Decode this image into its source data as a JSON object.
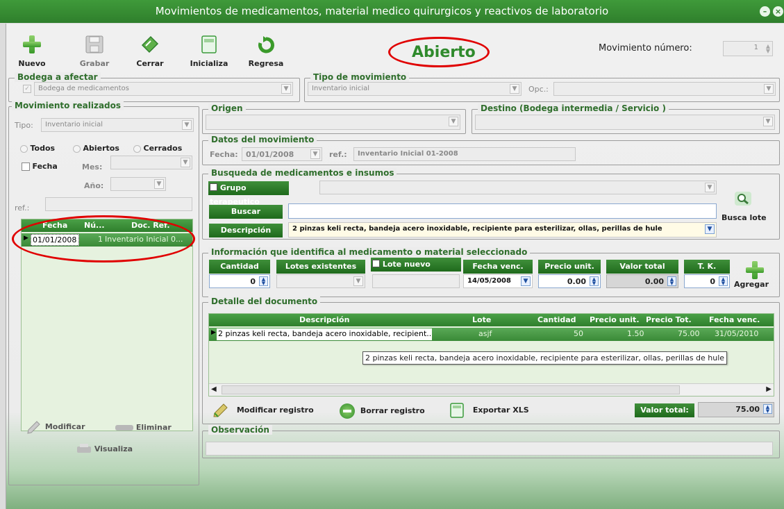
{
  "window": {
    "title": "Movimientos de medicamentos, material medico quirurgicos y reactivos de laboratorio",
    "minimize_icon": "minus-circle-icon",
    "close_icon": "close-circle-icon"
  },
  "toolbar": {
    "nuevo": "Nuevo",
    "grabar": "Grabar",
    "cerrar": "Cerrar",
    "inicializa": "Inicializa",
    "regresa": "Regresa"
  },
  "status": "Abierto",
  "movimiento": {
    "label": "Movimiento número:",
    "value": "1"
  },
  "bodega": {
    "legend": "Bodega a afectar",
    "value": "Bodega de medicamentos"
  },
  "tipo_movimiento": {
    "legend": "Tipo de movimiento",
    "value": "Inventario inicial",
    "opc_label": "Opc.:"
  },
  "realizados": {
    "legend": "Movimiento realizados",
    "tipo_label": "Tipo:",
    "tipo_value": "Inventario inicial",
    "todos": "Todos",
    "abiertos": "Abiertos",
    "cerrados": "Cerrados",
    "fecha_label": "Fecha",
    "mes_label": "Mes:",
    "anio_label": "Año:",
    "ref_label": "ref.:",
    "grid": {
      "headers": [
        "Fecha",
        "Nú...",
        "Doc. Ref."
      ],
      "rows": [
        {
          "fecha": "01/01/2008",
          "num": "1",
          "doc": "Inventario Inicial 0..."
        }
      ]
    },
    "modificar": "Modificar",
    "eliminar": "Eliminar",
    "visualiza": "Visualiza"
  },
  "origen": {
    "legend": "Origen"
  },
  "destino": {
    "legend": "Destino (Bodega intermedia / Servicio )"
  },
  "datos": {
    "legend": "Datos del movimiento",
    "fecha_label": "Fecha:",
    "fecha_value": "01/01/2008",
    "ref_label": "ref.:",
    "ref_value": "Inventario Inicial 01-2008"
  },
  "busqueda": {
    "legend": "Busqueda de medicamentos e insumos",
    "grupo_label": "Grupo terapeutico",
    "buscar_label": "Buscar",
    "descripcion_label": "Descripción",
    "descripcion_value": "2 pinzas keli recta, bandeja acero inoxidable, recipiente para esterilizar, ollas, perillas de hule",
    "busca_lote": "Busca lote"
  },
  "info": {
    "legend": "Información que identifica al medicamento o material seleccionado",
    "cantidad_label": "Cantidad",
    "cantidad_value": "0",
    "lotes_label": "Lotes existentes",
    "lote_nuevo_label": "Lote nuevo",
    "fecha_venc_label": "Fecha venc.",
    "fecha_venc_value": "14/05/2008",
    "precio_label": "Precio unit.",
    "precio_value": "0.00",
    "valor_label": "Valor total",
    "valor_value": "0.00",
    "tk_label": "T. K.",
    "tk_value": "0",
    "agregar": "Agregar"
  },
  "detalle": {
    "legend": "Detalle del documento",
    "headers": [
      "Descripción",
      "Lote",
      "Cantidad",
      "Precio unit.",
      "Precio Tot.",
      "Fecha venc."
    ],
    "rows": [
      {
        "descripcion": "2 pinzas keli recta, bandeja acero inoxidable, recipient...",
        "lote": "asjf",
        "cantidad": "50",
        "precio": "1.50",
        "total": "75.00",
        "fecha": "31/05/2010"
      }
    ],
    "tooltip": "2 pinzas keli recta, bandeja acero inoxidable, recipiente para esterilizar, ollas, perillas de hule",
    "modificar": "Modificar registro",
    "borrar": "Borrar registro",
    "exportar": "Exportar XLS",
    "valor_total_label": "Valor total:",
    "valor_total_value": "75.00"
  },
  "observacion": {
    "legend": "Observación"
  }
}
